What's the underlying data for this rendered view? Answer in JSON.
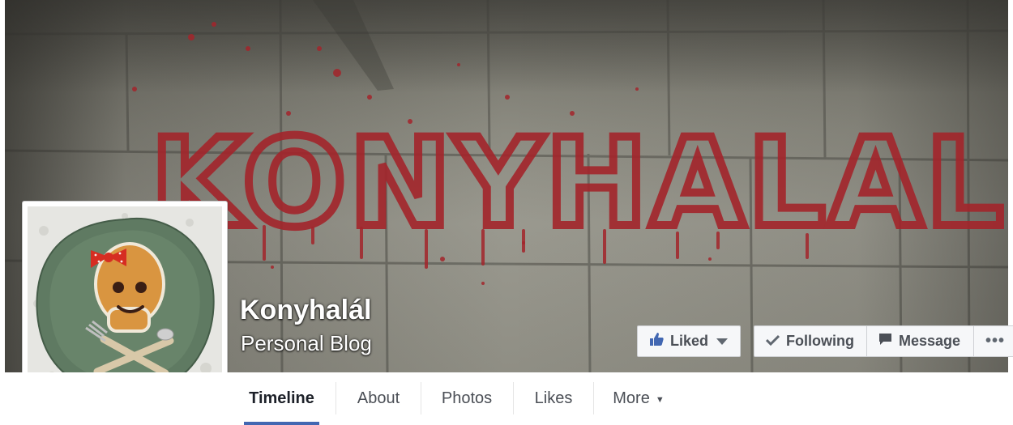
{
  "page": {
    "name": "Konyhalál",
    "category": "Personal Blog",
    "cover_text": "KONYHALAL"
  },
  "actions": {
    "liked": "Liked",
    "following": "Following",
    "message": "Message",
    "more_dots": "•••"
  },
  "tabs": [
    {
      "label": "Timeline",
      "active": true
    },
    {
      "label": "About"
    },
    {
      "label": "Photos"
    },
    {
      "label": "Likes"
    },
    {
      "label": "More"
    }
  ],
  "colors": {
    "accent": "#4267b2",
    "blood": "#a3252b",
    "button_bg": "#f6f7f9"
  },
  "icons": {
    "liked": "thumbs-up-icon",
    "liked_dropdown": "caret-down-icon",
    "following": "checkmark-icon",
    "message": "message-icon",
    "more_tab": "caret-down-icon"
  }
}
